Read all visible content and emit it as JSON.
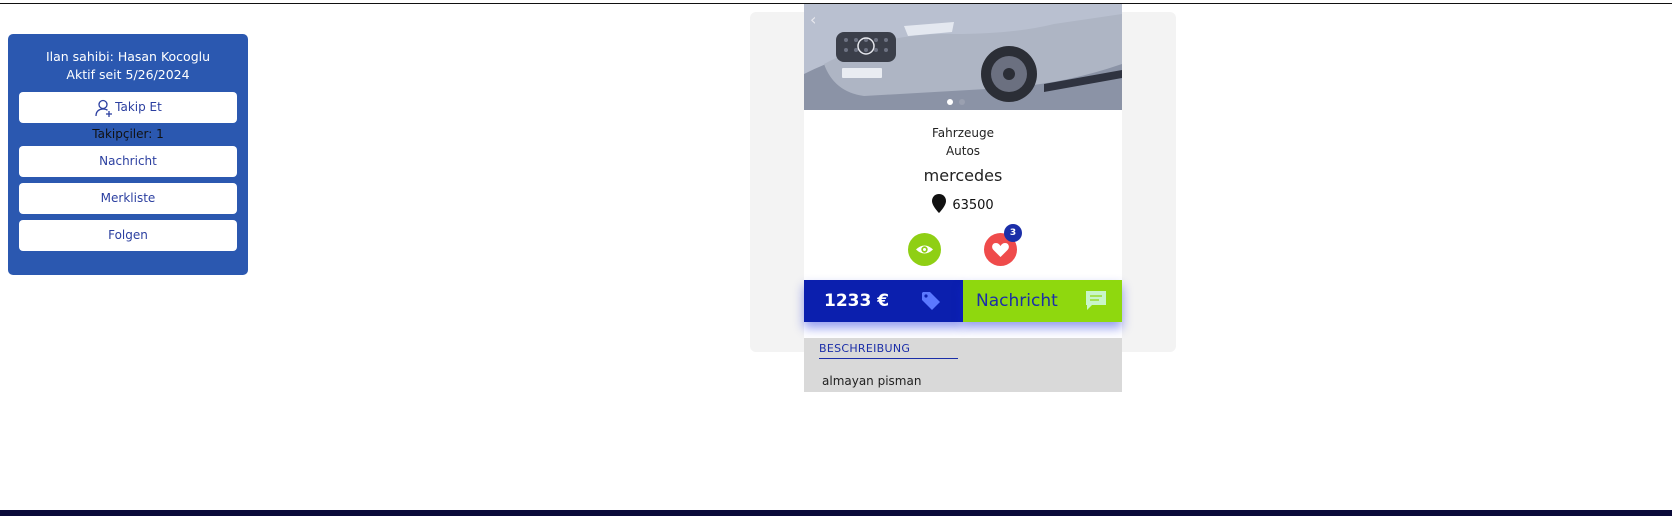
{
  "seller": {
    "owner_line": "Ilan sahibi: Hasan Kocoglu",
    "active_line": "Aktif seit 5/26/2024",
    "follow_button": "Takip Et",
    "followers": "Takipçiler: 1",
    "message_button": "Nachricht",
    "watchlist_button": "Merkliste",
    "follow_button_2": "Folgen",
    "brand_color": "#2b58b0"
  },
  "listing": {
    "category": "Fahrzeuge",
    "subcategory": "Autos",
    "title": "mercedes",
    "location": "63500",
    "likes_count": "3",
    "price": "1233 €",
    "message_label": "Nachricht",
    "description_tab": "BESCHREIBUNG",
    "description_text": "almayan pisman",
    "price_color": "#0b1fae",
    "message_color": "#8fd80e",
    "icons": [
      "chevron-left-icon",
      "location-pin-icon",
      "eye-icon",
      "heart-icon",
      "price-tag-icon",
      "chat-bubble-icon",
      "user-add-icon"
    ],
    "image_dots": 2,
    "active_image": 1
  }
}
